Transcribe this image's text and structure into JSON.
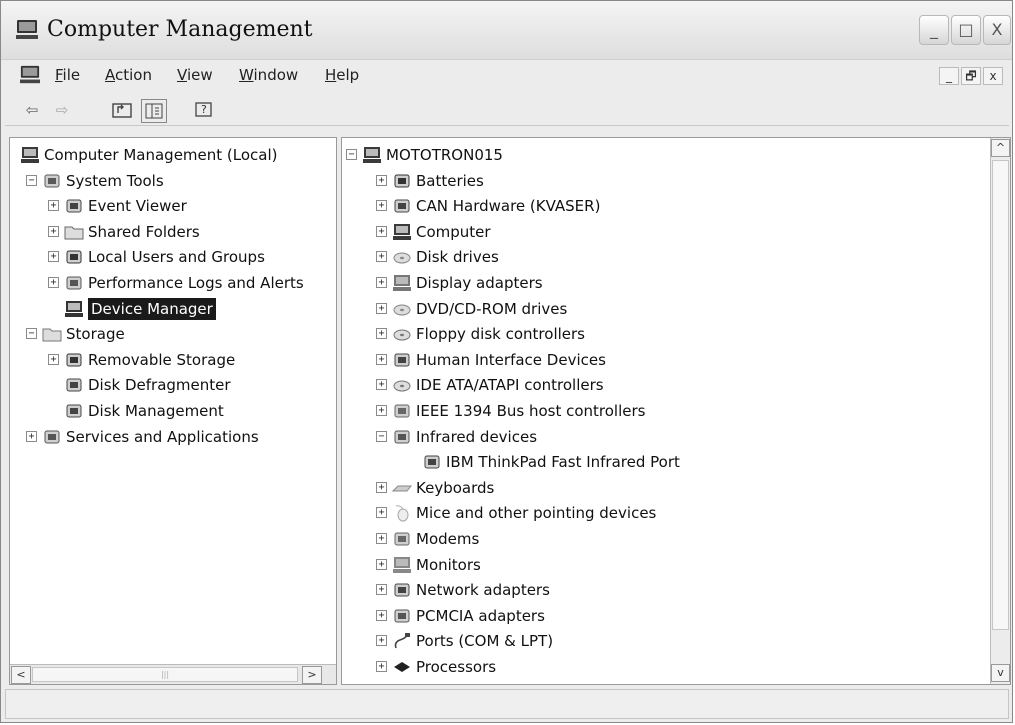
{
  "window": {
    "title": "Computer Management",
    "buttons": {
      "minimize": "_",
      "maximize": "□",
      "close": "X"
    }
  },
  "menubar": {
    "items": [
      {
        "label": "File",
        "accel": "F",
        "rest": "ile"
      },
      {
        "label": "Action",
        "accel": "A",
        "rest": "ction"
      },
      {
        "label": "View",
        "accel": "V",
        "rest": "iew"
      },
      {
        "label": "Window",
        "accel": "W",
        "rest": "indow"
      },
      {
        "label": "Help",
        "accel": "H",
        "rest": "elp"
      }
    ],
    "mdi": {
      "minimize": "_",
      "restore": "🗗",
      "close": "x"
    }
  },
  "toolbar": {
    "back": "⇦",
    "forward": "⇨"
  },
  "left_tree": [
    {
      "label": "Computer Management (Local)",
      "icon": "computer-icon",
      "level": 0,
      "exp": ""
    },
    {
      "label": "System Tools",
      "icon": "system-tools-icon",
      "level": 1,
      "exp": "−"
    },
    {
      "label": "Event Viewer",
      "icon": "event-viewer-icon",
      "level": 2,
      "exp": "+"
    },
    {
      "label": "Shared Folders",
      "icon": "shared-folders-icon",
      "level": 2,
      "exp": "+"
    },
    {
      "label": "Local Users and Groups",
      "icon": "users-icon",
      "level": 2,
      "exp": "+"
    },
    {
      "label": "Performance Logs and Alerts",
      "icon": "performance-icon",
      "level": 2,
      "exp": "+"
    },
    {
      "label": "Device Manager",
      "icon": "device-manager-icon",
      "level": 2,
      "exp": "",
      "selected": true
    },
    {
      "label": "Storage",
      "icon": "storage-icon",
      "level": 1,
      "exp": "−"
    },
    {
      "label": "Removable Storage",
      "icon": "removable-storage-icon",
      "level": 2,
      "exp": "+"
    },
    {
      "label": "Disk Defragmenter",
      "icon": "defrag-icon",
      "level": 2,
      "exp": ""
    },
    {
      "label": "Disk Management",
      "icon": "disk-management-icon",
      "level": 2,
      "exp": ""
    },
    {
      "label": "Services and Applications",
      "icon": "services-icon",
      "level": 1,
      "exp": "+"
    }
  ],
  "left_scroll": {
    "left": "<",
    "right": ">",
    "grip": "|||"
  },
  "right_tree": [
    {
      "label": "MOTOTRON015",
      "icon": "computer-icon",
      "level": 0,
      "exp": "−"
    },
    {
      "label": "Batteries",
      "icon": "battery-icon",
      "level": 1,
      "exp": "+"
    },
    {
      "label": "CAN Hardware (KVASER)",
      "icon": "can-hardware-icon",
      "level": 1,
      "exp": "+"
    },
    {
      "label": "Computer",
      "icon": "computer-icon",
      "level": 1,
      "exp": "+"
    },
    {
      "label": "Disk drives",
      "icon": "disk-drive-icon",
      "level": 1,
      "exp": "+"
    },
    {
      "label": "Display adapters",
      "icon": "display-adapter-icon",
      "level": 1,
      "exp": "+"
    },
    {
      "label": "DVD/CD-ROM drives",
      "icon": "dvd-icon",
      "level": 1,
      "exp": "+"
    },
    {
      "label": "Floppy disk controllers",
      "icon": "floppy-controller-icon",
      "level": 1,
      "exp": "+"
    },
    {
      "label": "Human Interface Devices",
      "icon": "hid-icon",
      "level": 1,
      "exp": "+"
    },
    {
      "label": "IDE ATA/ATAPI controllers",
      "icon": "ide-controller-icon",
      "level": 1,
      "exp": "+"
    },
    {
      "label": "IEEE 1394 Bus host controllers",
      "icon": "ieee1394-icon",
      "level": 1,
      "exp": "+"
    },
    {
      "label": "Infrared devices",
      "icon": "infrared-icon",
      "level": 1,
      "exp": "−"
    },
    {
      "label": "IBM ThinkPad Fast Infrared Port",
      "icon": "infrared-port-icon",
      "level": 2,
      "exp": ""
    },
    {
      "label": "Keyboards",
      "icon": "keyboard-icon",
      "level": 1,
      "exp": "+"
    },
    {
      "label": "Mice and other pointing devices",
      "icon": "mouse-icon",
      "level": 1,
      "exp": "+"
    },
    {
      "label": "Modems",
      "icon": "modem-icon",
      "level": 1,
      "exp": "+"
    },
    {
      "label": "Monitors",
      "icon": "monitor-icon",
      "level": 1,
      "exp": "+"
    },
    {
      "label": "Network adapters",
      "icon": "network-adapter-icon",
      "level": 1,
      "exp": "+"
    },
    {
      "label": "PCMCIA adapters",
      "icon": "pcmcia-icon",
      "level": 1,
      "exp": "+"
    },
    {
      "label": "Ports (COM & LPT)",
      "icon": "ports-icon",
      "level": 1,
      "exp": "+"
    },
    {
      "label": "Processors",
      "icon": "processor-icon",
      "level": 1,
      "exp": "+"
    }
  ],
  "right_scroll": {
    "up": "^",
    "down": "v"
  }
}
